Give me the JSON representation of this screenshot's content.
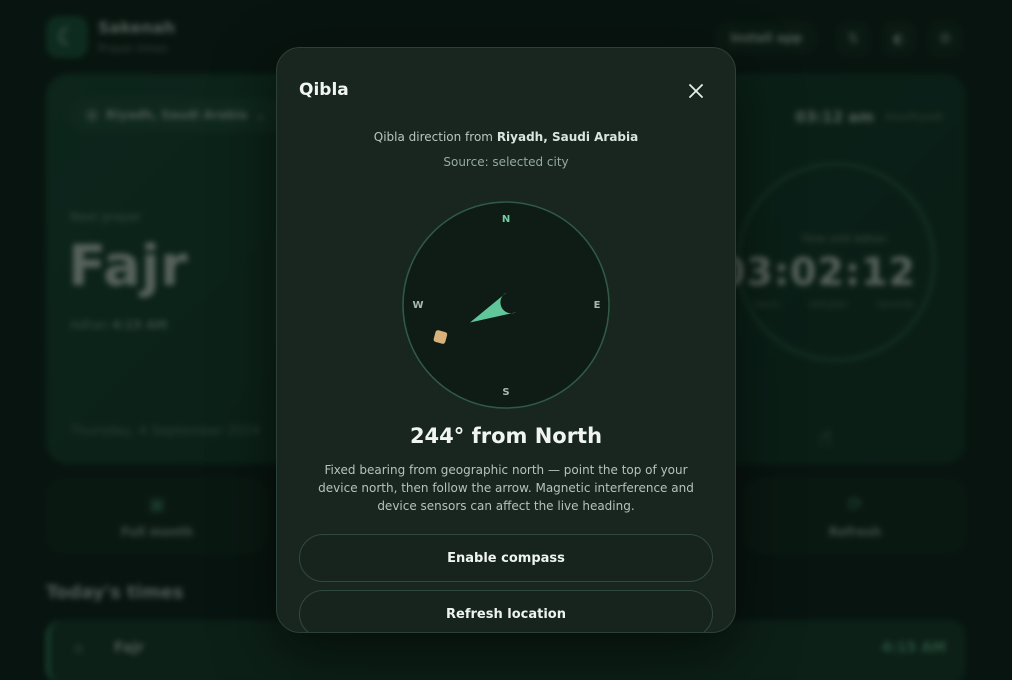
{
  "app": {
    "brand_name": "Sakenah",
    "brand_sub": "Prayer times",
    "install_label": "Install app",
    "location_chip": "Riyadh, Saudi Arabia",
    "next_prayer_label": "Next prayer",
    "next_prayer_name": "Fajr",
    "adhan_label": "Adhan",
    "adhan_time": "4:15 AM",
    "date": "Thursday, 4 September 2024",
    "current_time": "03:12 am",
    "timezone": "Asia/Riyadh",
    "countdown_label": "Time until Adhan",
    "countdown": {
      "hours": "03",
      "minutes": "02",
      "seconds": "12"
    },
    "countdown_units": {
      "hours": "hours",
      "minutes": "minutes",
      "seconds": "seconds"
    },
    "quick_actions": [
      {
        "label": "Full month",
        "icon": "calendar-icon"
      },
      {
        "label": "Refresh",
        "icon": "refresh-icon"
      }
    ],
    "section_title": "Today's times",
    "rows": [
      {
        "name": "Fajr",
        "time": "4:15 AM",
        "icon": "sunrise-icon"
      }
    ]
  },
  "modal": {
    "title": "Qibla",
    "direction_prefix": "Qibla direction from",
    "direction_city": "Riyadh, Saudi Arabia",
    "source": "Source: selected city",
    "compass": {
      "labels": {
        "n": "N",
        "e": "E",
        "s": "S",
        "w": "W"
      },
      "bearing_deg": 244,
      "accent": "#5fc79a",
      "kaaba_color": "#d8b27a"
    },
    "bearing_text": "244° from North",
    "explanation": "Fixed bearing from geographic north — point the top of your device north, then follow the arrow. Magnetic interference and device sensors can affect the live heading.",
    "buttons": {
      "enable_compass": "Enable compass",
      "refresh_location": "Refresh location"
    }
  }
}
